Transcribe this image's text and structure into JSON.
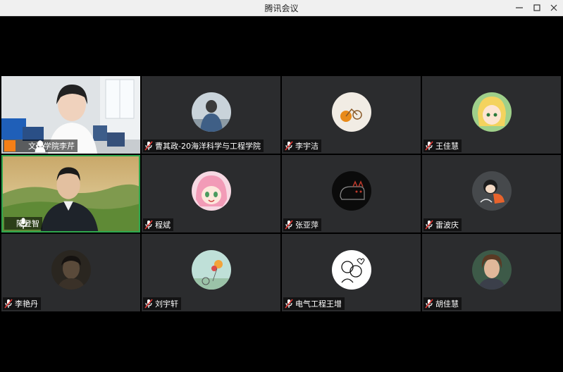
{
  "window": {
    "title": "腾讯会议"
  },
  "participants": [
    {
      "name": "文理学院李芹",
      "muted": false,
      "host": true,
      "video": "office"
    },
    {
      "name": "曹其政-20海洋科学与工程学院",
      "muted": true,
      "avatar": "person-back"
    },
    {
      "name": "李宇洁",
      "muted": true,
      "avatar": "bicycle"
    },
    {
      "name": "王佳慧",
      "muted": true,
      "avatar": "anime-blonde"
    },
    {
      "name": "陈登智",
      "muted": false,
      "video": "landscape"
    },
    {
      "name": "程斌",
      "muted": true,
      "avatar": "anime-pink"
    },
    {
      "name": "张亚萍",
      "muted": true,
      "avatar": "black-cat"
    },
    {
      "name": "雷波庆",
      "muted": true,
      "avatar": "cartoon-girl"
    },
    {
      "name": "李艳丹",
      "muted": true,
      "avatar": "dark-portrait"
    },
    {
      "name": "刘宇轩",
      "muted": true,
      "avatar": "balloon-scene"
    },
    {
      "name": "电气工程王增",
      "muted": true,
      "avatar": "line-drawing"
    },
    {
      "name": "胡佳慧",
      "muted": true,
      "avatar": "boy-portrait"
    }
  ]
}
